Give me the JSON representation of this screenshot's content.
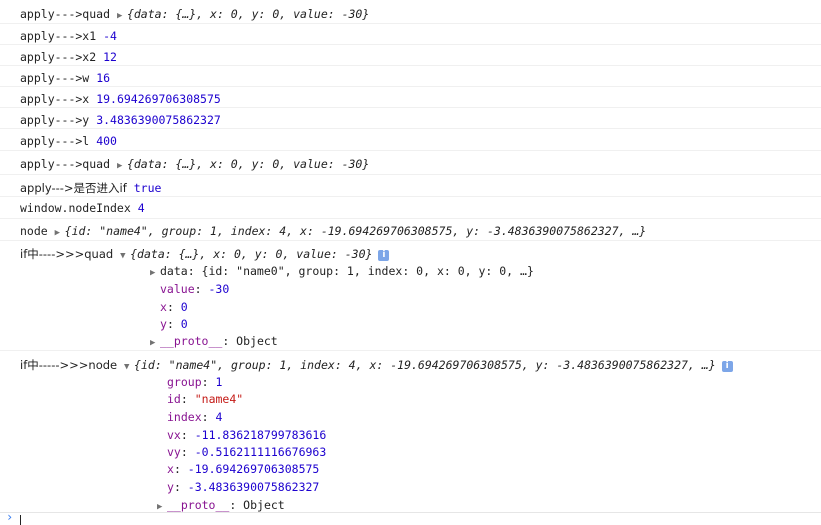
{
  "console": {
    "l1": {
      "label": "apply--->quad",
      "preview": "{data: {…}, x: 0, y: 0, value: -30}"
    },
    "l2": {
      "label": "apply--->x1",
      "value": "-4"
    },
    "l3": {
      "label": "apply--->x2",
      "value": "12"
    },
    "l4": {
      "label": "apply--->w",
      "value": "16"
    },
    "l5": {
      "label": "apply--->x",
      "value": "19.694269706308575"
    },
    "l6": {
      "label": "apply--->y",
      "value": "3.4836390075862327"
    },
    "l7": {
      "label": "apply--->l",
      "value": "400"
    },
    "l8": {
      "label": "apply--->quad",
      "preview": "{data: {…}, x: 0, y: 0, value: -30}"
    },
    "l9": {
      "label": "apply--->是否进入if",
      "value": "true"
    },
    "l10": {
      "label": "window.nodeIndex",
      "value": "4"
    },
    "l11": {
      "label": "node",
      "preview": "{id: \"name4\", group: 1, index: 4, x: -19.694269706308575, y: -3.4836390075862327, …}"
    },
    "l12": {
      "label": "if中---->>>quad",
      "preview": "{data: {…}, x: 0, y: 0, value: -30}",
      "props": {
        "data": "data: {id: \"name0\", group: 1, index: 0, x: 0, y: 0, …}",
        "value_key": "value",
        "value_val": "-30",
        "x_key": "x",
        "x_val": "0",
        "y_key": "y",
        "y_val": "0",
        "proto_key": "__proto__",
        "proto_val": "Object"
      }
    },
    "l13": {
      "label": "if中----->>>node",
      "preview": "{id: \"name4\", group: 1, index: 4, x: -19.694269706308575, y: -3.4836390075862327, …}",
      "props": {
        "group_key": "group",
        "group_val": "1",
        "id_key": "id",
        "id_val": "\"name4\"",
        "index_key": "index",
        "index_val": "4",
        "vx_key": "vx",
        "vx_val": "-11.836218799783616",
        "vy_key": "vy",
        "vy_val": "-0.5162111116676963",
        "x_key": "x",
        "x_val": "-19.694269706308575",
        "y_key": "y",
        "y_val": "-3.4836390075862327",
        "proto_key": "__proto__",
        "proto_val": "Object"
      }
    }
  },
  "icons": {
    "expand": "triangle-right-icon",
    "expanded": "triangle-down-icon",
    "info": "info-icon",
    "prompt": "prompt-caret-icon"
  },
  "colors": {
    "number": "#1c00cf",
    "string": "#c41a16",
    "key": "#881391",
    "info": "#7da6e8"
  }
}
